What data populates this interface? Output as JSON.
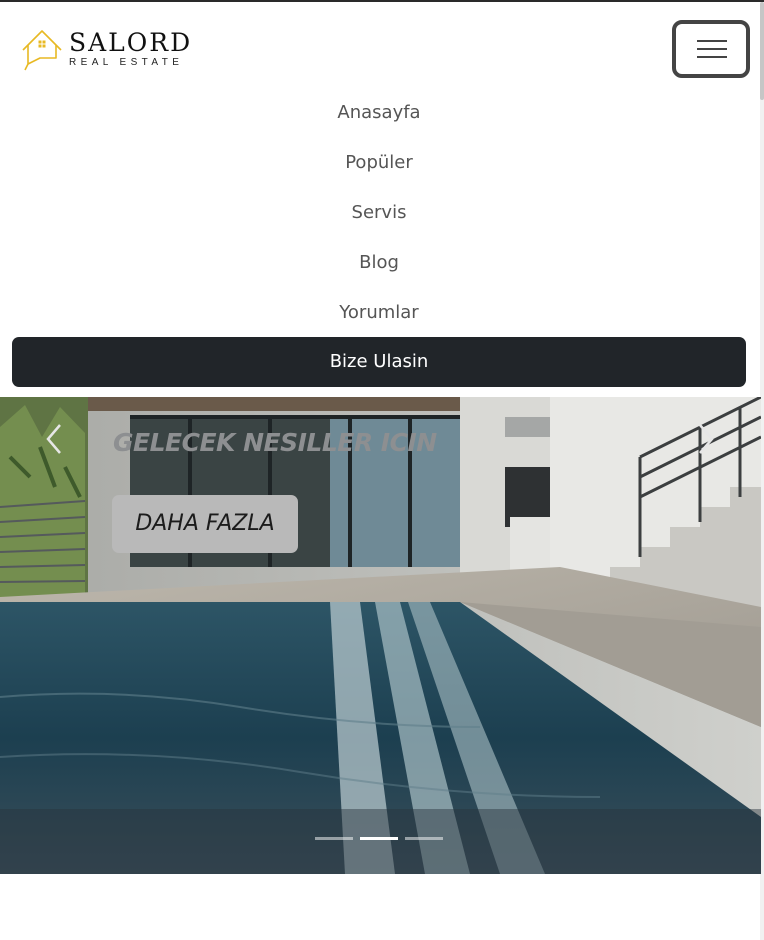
{
  "brand": {
    "name": "SALORD",
    "tagline": "REAL ESTATE",
    "accent_color": "#e8b923"
  },
  "navbar": {
    "toggler_icon": "hamburger-menu-icon",
    "links": [
      {
        "label": "Anasayfa"
      },
      {
        "label": "Popüler"
      },
      {
        "label": "Servis"
      },
      {
        "label": "Blog"
      },
      {
        "label": "Yorumlar"
      }
    ],
    "cta_label": "Bize Ulasin",
    "cta_color": "#212529"
  },
  "carousel": {
    "slide_title": "GELECEK NESILLER ICIN",
    "slide_button": "DAHA FAZLA",
    "prev_icon": "chevron-left-icon",
    "next_icon": "chevron-right-icon",
    "slide_count": 3,
    "active_slide": 2
  }
}
